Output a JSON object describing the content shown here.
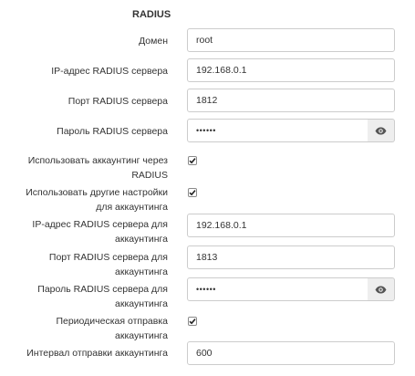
{
  "section": {
    "title": "RADIUS"
  },
  "fields": {
    "domain": {
      "label": "Домен",
      "value": "root"
    },
    "radius_ip": {
      "label": "IP-адрес RADIUS сервера",
      "value": "192.168.0.1"
    },
    "radius_port": {
      "label": "Порт RADIUS сервера",
      "value": "1812"
    },
    "radius_password": {
      "label": "Пароль RADIUS сервера",
      "value": "••••••",
      "toggle_icon": "eye-icon"
    },
    "use_accounting": {
      "label_line1": "Использовать аккаунтинг через",
      "label_line2": "RADIUS",
      "checked": true
    },
    "use_other_settings": {
      "label_line1": "Использовать другие настройки",
      "label_line2": "для аккаунтинга",
      "checked": true
    },
    "acct_ip": {
      "label_line1": "IP-адрес RADIUS сервера для",
      "label_line2": "аккаунтинга",
      "value": "192.168.0.1"
    },
    "acct_port": {
      "label_line1": "Порт RADIUS сервера для",
      "label_line2": "аккаунтинга",
      "value": "1813"
    },
    "acct_password": {
      "label_line1": "Пароль RADIUS сервера для",
      "label_line2": "аккаунтинга",
      "value": "••••••",
      "toggle_icon": "eye-icon"
    },
    "periodic_send": {
      "label_line1": "Периодическая отправка",
      "label_line2": "аккаунтинга",
      "checked": true
    },
    "acct_interval": {
      "label": "Интервал отправки аккаунтинга",
      "value": "600"
    }
  }
}
